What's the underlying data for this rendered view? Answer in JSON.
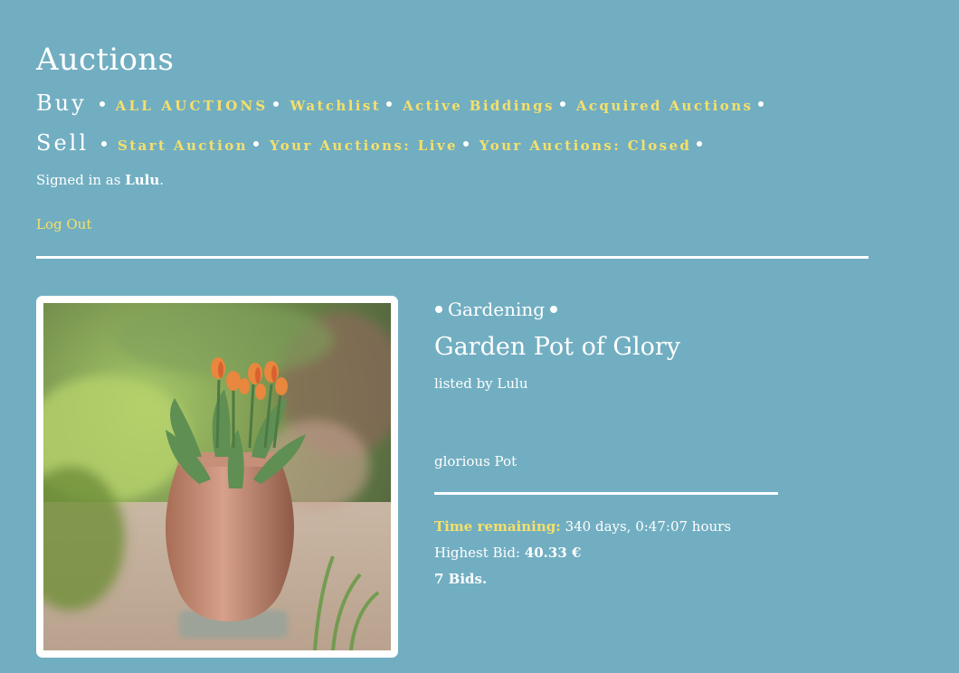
{
  "site": {
    "title": "Auctions"
  },
  "nav": {
    "buy": {
      "heading": "Buy",
      "links": [
        "ALL AUCTIONS",
        "Watchlist",
        "Active Biddings",
        "Acquired Auctions"
      ]
    },
    "sell": {
      "heading": "Sell",
      "links": [
        "Start Auction",
        "Your Auctions: Live",
        "Your Auctions: Closed"
      ]
    }
  },
  "user": {
    "signed_in_prefix": "Signed in as",
    "username": "Lulu",
    "signed_in_suffix": ".",
    "logout_label": "Log Out"
  },
  "listing": {
    "category": "Gardening",
    "title": "Garden Pot of Glory",
    "listed_by": "listed by Lulu",
    "description": "glorious Pot",
    "time_label": "Time remaining:",
    "time_value": "340 days, 0:47:07 hours",
    "highest_bid_label": "Highest Bid:",
    "highest_bid_value": "40.33 €",
    "bid_count": "7 Bids.",
    "image_subject": "terracotta-pot-with-tulips"
  },
  "colors": {
    "background": "#72aec1",
    "accent_yellow": "#f5e06a",
    "text": "#ffffff"
  }
}
